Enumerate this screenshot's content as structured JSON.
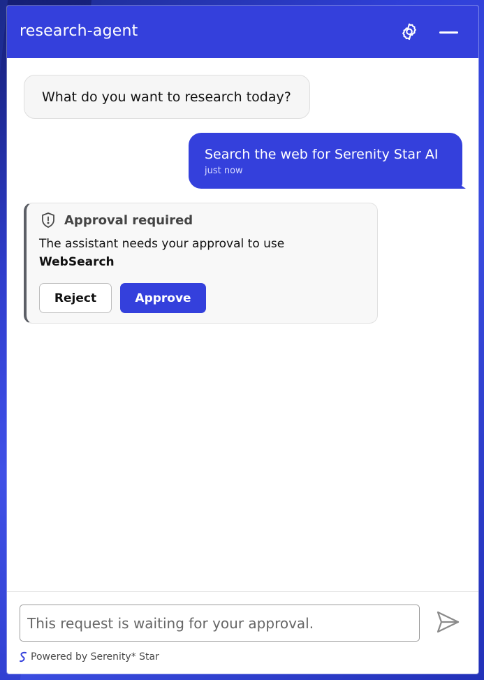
{
  "colors": {
    "accent": "#3440dc",
    "header_text": "#ffffff",
    "bot_bubble_bg": "#f6f6f6",
    "card_border": "#5c5f66"
  },
  "header": {
    "title": "research-agent",
    "settings_icon": "gear-icon",
    "minimize_icon": "minimize-icon"
  },
  "messages": [
    {
      "role": "assistant",
      "text": "What do you want to research today?"
    },
    {
      "role": "user",
      "text": "Search the web for Serenity Star AI",
      "time": "just now"
    }
  ],
  "approval": {
    "icon": "shield-alert-icon",
    "title": "Approval required",
    "description": "The assistant needs your approval to use",
    "tool_name": "WebSearch",
    "reject_label": "Reject",
    "approve_label": "Approve"
  },
  "composer": {
    "placeholder": "This request is waiting for your approval.",
    "send_icon": "send-icon"
  },
  "footer": {
    "powered_by": "Powered by Serenity* Star",
    "logo_icon": "serenity-logo-icon"
  }
}
